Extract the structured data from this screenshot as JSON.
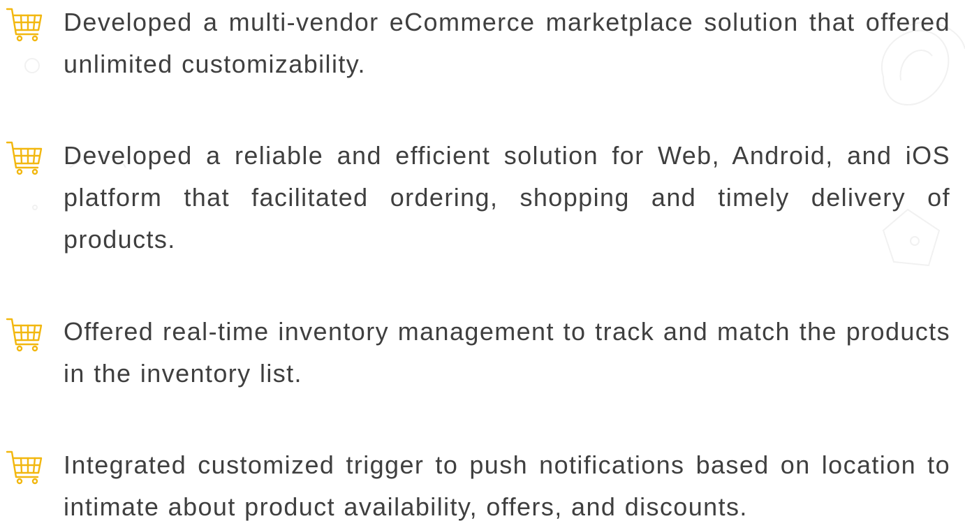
{
  "icon_name": "shopping-cart-icon",
  "accent_color": "#f2b70f",
  "text_color": "#3f3f3f",
  "features": [
    {
      "text": "Developed a multi-vendor eCommerce marketplace solution that offered unlimited customizability."
    },
    {
      "text": "Developed a reliable and efficient solution for Web, Android, and iOS platform that facilitated ordering, shopping and timely delivery of products."
    },
    {
      "text": "Offered real-time inventory management to track and match the products in the inventory list."
    },
    {
      "text": "Integrated customized trigger to push notifications based on location to intimate about product availability, offers, and discounts."
    }
  ]
}
